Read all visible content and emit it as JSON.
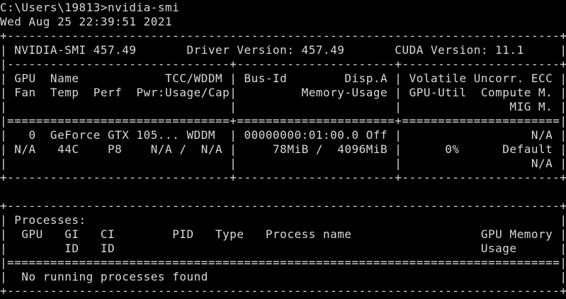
{
  "terminal": {
    "prompt": "C:\\Users\\19813>nvidia-smi",
    "timestamp": "Wed Aug 25 22:39:51 2021",
    "lines": [
      "+-----------------------------------------------------------------------------+",
      "| NVIDIA-SMI 457.49       Driver Version: 457.49       CUDA Version: 11.1     |",
      "|-------------------------------+----------------------+----------------------+",
      "| GPU  Name            TCC/WDDM | Bus-Id        Disp.A | Volatile Uncorr. ECC |",
      "| Fan  Temp  Perf  Pwr:Usage/Cap|         Memory-Usage | GPU-Util  Compute M. |",
      "|                               |                      |               MIG M. |",
      "|===============================+======================+======================|",
      "|   0  GeForce GTX 105... WDDM  | 00000000:01:00.0 Off |                  N/A |",
      "| N/A   44C    P8    N/A /  N/A |     78MiB /  4096MiB |      0%      Default |",
      "|                               |                      |                  N/A |",
      "+-------------------------------+----------------------+----------------------+",
      "",
      "+-----------------------------------------------------------------------------+",
      "| Processes:                                                                  |",
      "|  GPU   GI   CI        PID   Type   Process name                  GPU Memory |",
      "|        ID   ID                                                   Usage      |",
      "|=============================================================================|",
      "|  No running processes found                                                 |",
      "+-----------------------------------------------------------------------------+"
    ]
  }
}
